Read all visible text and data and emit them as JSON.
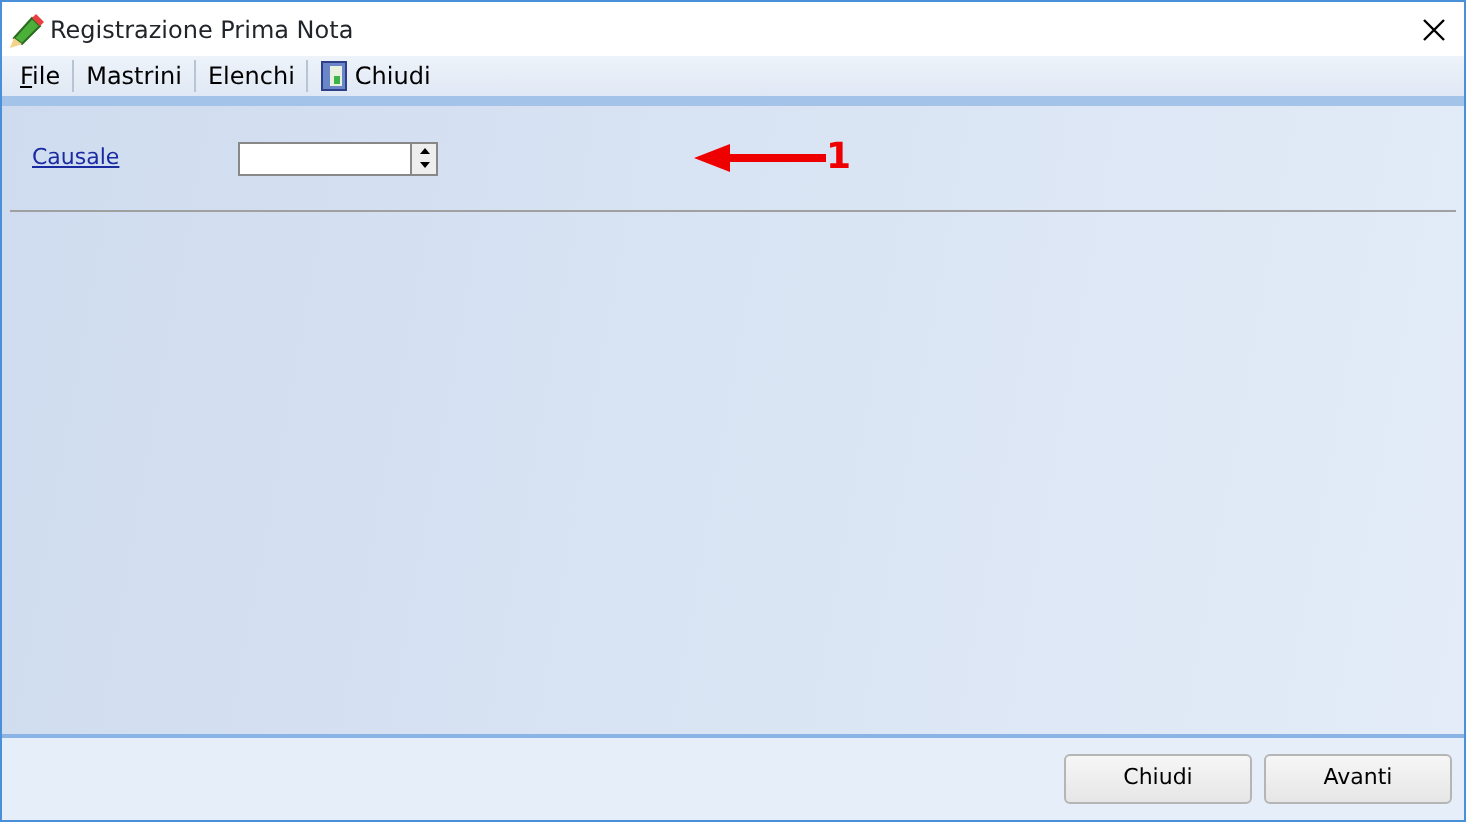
{
  "window": {
    "title": "Registrazione Prima Nota"
  },
  "menu": [
    {
      "label": "File",
      "mnemonic": true,
      "kind": "text"
    },
    {
      "label": "Mastrini",
      "mnemonic": false,
      "kind": "text"
    },
    {
      "label": "Elenchi",
      "mnemonic": false,
      "kind": "text"
    },
    {
      "label": "Chiudi",
      "mnemonic": false,
      "kind": "door"
    }
  ],
  "form": {
    "field_label": "Causale",
    "annotation": "1"
  },
  "buttons": [
    "Chiudi",
    "Avanti"
  ]
}
